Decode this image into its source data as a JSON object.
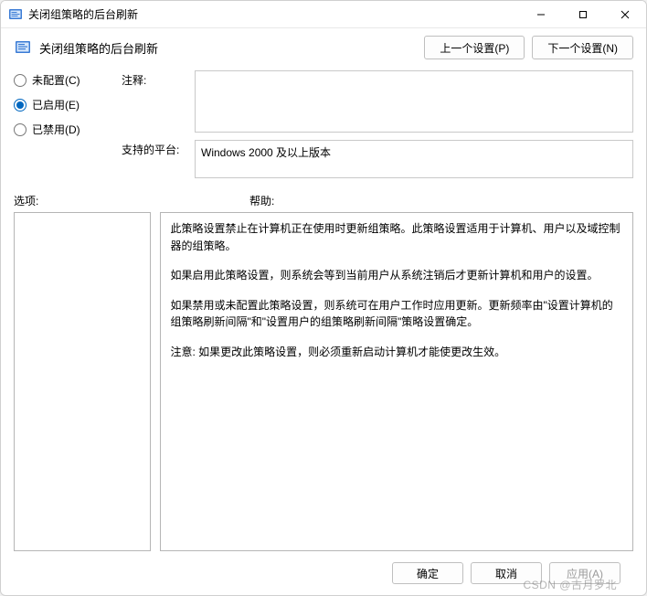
{
  "window": {
    "title": "关闭组策略的后台刷新"
  },
  "header": {
    "title": "关闭组策略的后台刷新",
    "prev_button": "上一个设置(P)",
    "next_button": "下一个设置(N)"
  },
  "radios": {
    "not_configured": "未配置(C)",
    "enabled": "已启用(E)",
    "disabled": "已禁用(D)",
    "selected": "enabled"
  },
  "fields": {
    "comment_label": "注释:",
    "comment_value": "",
    "platform_label": "支持的平台:",
    "platform_value": "Windows 2000 及以上版本"
  },
  "labels": {
    "options": "选项:",
    "help": "帮助:"
  },
  "help": {
    "p1": "此策略设置禁止在计算机正在使用时更新组策略。此策略设置适用于计算机、用户以及域控制器的组策略。",
    "p2": "如果启用此策略设置，则系统会等到当前用户从系统注销后才更新计算机和用户的设置。",
    "p3": "如果禁用或未配置此策略设置，则系统可在用户工作时应用更新。更新频率由\"设置计算机的组策略刷新间隔\"和\"设置用户的组策略刷新间隔\"策略设置确定。",
    "p4": "注意: 如果更改此策略设置，则必须重新启动计算机才能使更改生效。"
  },
  "footer": {
    "ok": "确定",
    "cancel": "取消",
    "apply": "应用(A)"
  },
  "watermark": "CSDN @古月罗北"
}
